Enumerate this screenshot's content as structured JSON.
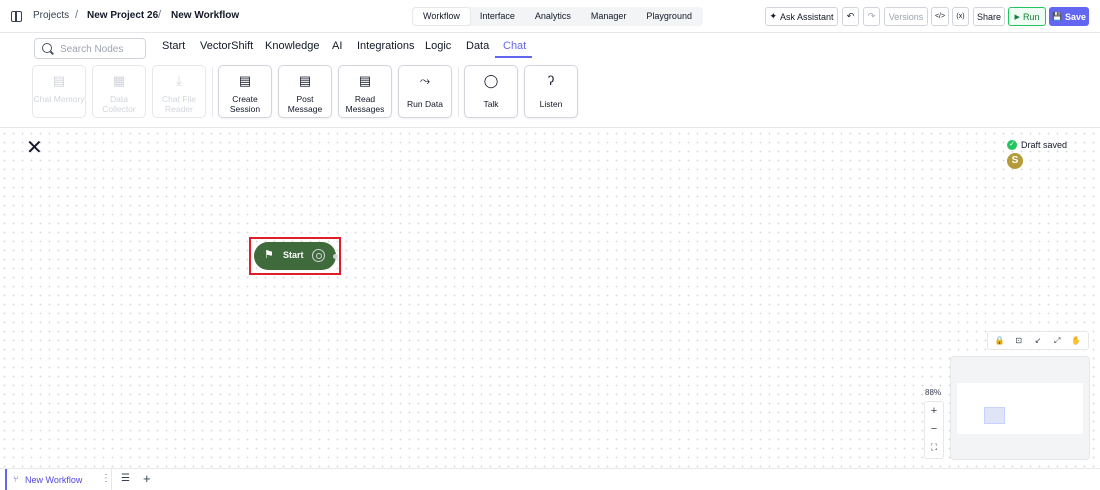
{
  "breadcrumb": {
    "projects": "Projects",
    "sep": "/",
    "project": "New Project 26",
    "workflow": "New Workflow"
  },
  "mode_tabs": [
    "Workflow",
    "Interface",
    "Analytics",
    "Manager",
    "Playground"
  ],
  "actions": {
    "ask_assistant": "Ask Assistant",
    "undo": "↶",
    "redo": "↷",
    "versions": "Versions",
    "code": "</>",
    "vars": "(x)",
    "share": "Share",
    "run": "Run",
    "save": "Save"
  },
  "search": {
    "placeholder": "Search Nodes"
  },
  "categories": [
    "Start",
    "VectorShift",
    "Knowledge",
    "AI",
    "Integrations",
    "Logic",
    "Data",
    "Chat"
  ],
  "nodes": [
    {
      "label": "Chat Memory",
      "icon": "chat-icon",
      "glyph": "▤"
    },
    {
      "label": "Data Collector",
      "icon": "document-icon",
      "glyph": "▦"
    },
    {
      "label": "Chat File Reader",
      "icon": "download-icon",
      "glyph": "⤓"
    },
    {
      "label": "Create Session",
      "icon": "chat-icon",
      "glyph": "▤"
    },
    {
      "label": "Post Message",
      "icon": "chat-icon",
      "glyph": "▤"
    },
    {
      "label": "Read Messages",
      "icon": "chat-icon",
      "glyph": "▤"
    },
    {
      "label": "Run Data",
      "icon": "sparkline-icon",
      "glyph": "⤳"
    },
    {
      "label": "Talk",
      "icon": "speech-bubble-icon",
      "glyph": "◯"
    },
    {
      "label": "Listen",
      "icon": "ear-icon",
      "glyph": "ʔ"
    }
  ],
  "canvas": {
    "close": "✕",
    "draft_status": "Draft saved",
    "avatar_initial": "S",
    "start_node": {
      "label": "Start",
      "icon": "flag-icon",
      "glyph": "⚑"
    },
    "zoom": "88%",
    "zoom_in": "+",
    "zoom_out": "−",
    "fit": "⛶",
    "controls": [
      "🔒",
      "⊡",
      "↙",
      "⤢",
      "✋"
    ]
  },
  "bottom": {
    "workflow_tab": "New Workflow",
    "more": "⋮",
    "list": "☰",
    "add": "+"
  }
}
